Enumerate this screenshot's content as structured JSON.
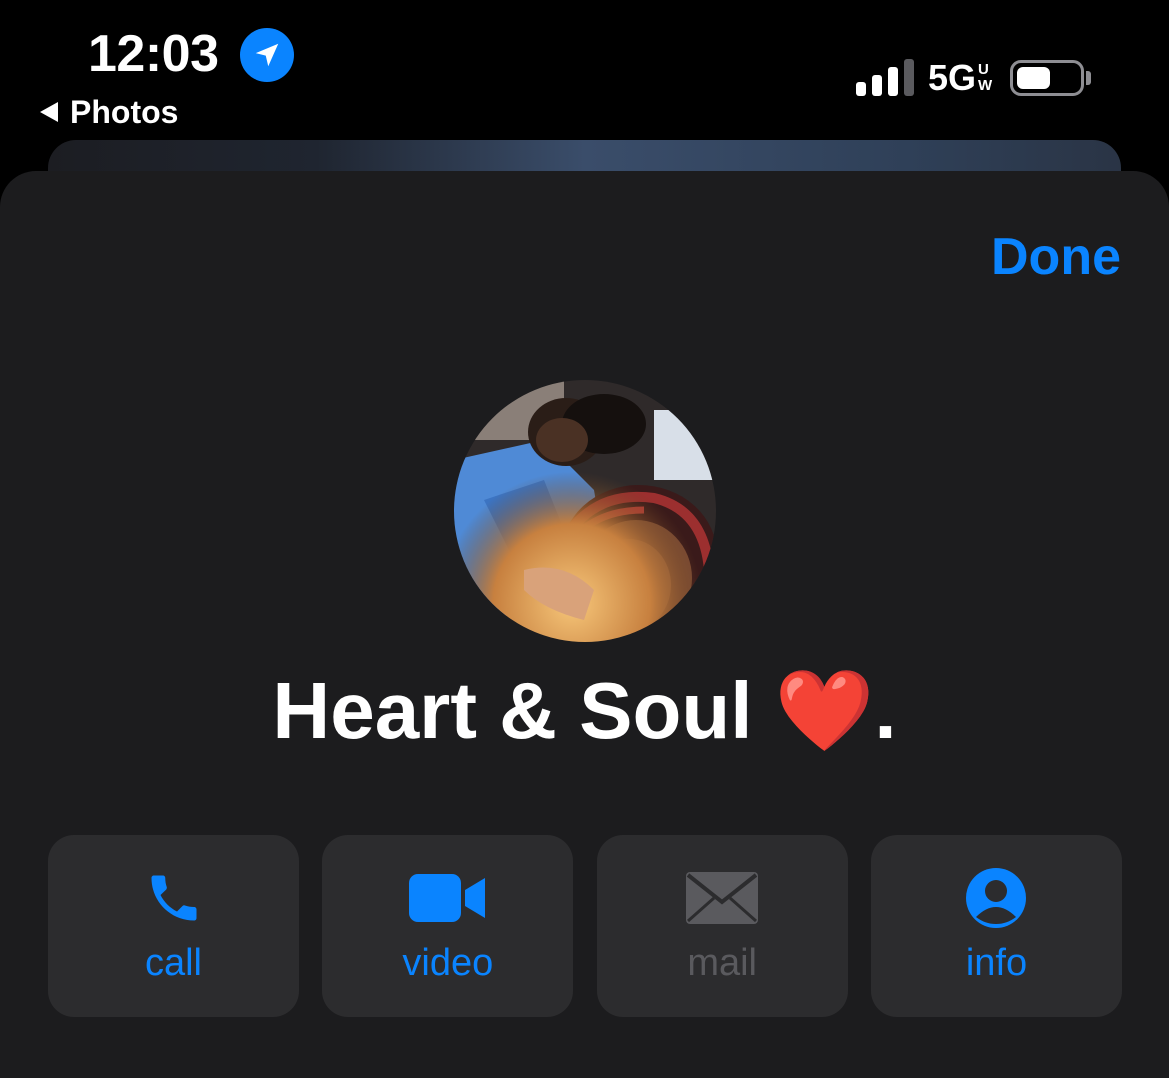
{
  "status_bar": {
    "time": "12:03",
    "back_label": "Photos",
    "network": "5G",
    "network_sup_top": "U",
    "network_sup_bottom": "W",
    "battery_level": 0.55
  },
  "sheet": {
    "done_label": "Done",
    "contact_name": "Heart & Soul ❤️."
  },
  "actions": [
    {
      "label": "call",
      "icon": "phone-icon",
      "enabled": true
    },
    {
      "label": "video",
      "icon": "video-camera-icon",
      "enabled": true
    },
    {
      "label": "mail",
      "icon": "envelope-icon",
      "enabled": false
    },
    {
      "label": "info",
      "icon": "person-circle-icon",
      "enabled": true
    }
  ],
  "colors": {
    "accent": "#0a84ff",
    "sheet_background": "#1c1c1e",
    "button_background": "#2c2c2e",
    "disabled": "#5a5a5e"
  }
}
